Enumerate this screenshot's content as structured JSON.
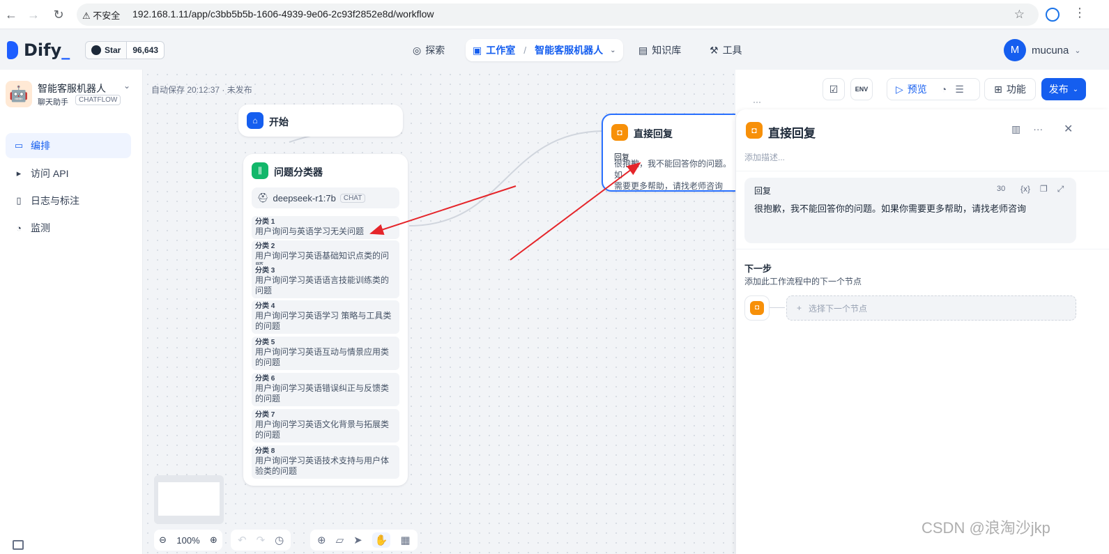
{
  "browser": {
    "insecure_label": "不安全",
    "url": "192.168.1.11/app/c3bb5b5b-1606-4939-9e06-2c93f2852e8d/workflow"
  },
  "header": {
    "logo": "Dify",
    "github": {
      "label": "Star",
      "count": "96,643"
    },
    "nav": {
      "explore": "探索",
      "studio": "工作室",
      "current_app": "智能客服机器人",
      "knowledge": "知识库",
      "tools": "工具"
    },
    "user": {
      "initial": "M",
      "name": "mucuna"
    }
  },
  "sidebar": {
    "app_name": "智能客服机器人",
    "app_type": "聊天助手",
    "app_mode": "CHATFLOW",
    "items": [
      {
        "label": "编排",
        "icon": "layout-icon"
      },
      {
        "label": "访问 API",
        "icon": "terminal-icon"
      },
      {
        "label": "日志与标注",
        "icon": "file-icon"
      },
      {
        "label": "监测",
        "icon": "monitor-icon"
      }
    ]
  },
  "canvas": {
    "autosave": "自动保存 20:12:37 · 未发布",
    "start_node": {
      "title": "开始"
    },
    "classifier_node": {
      "title": "问题分类器",
      "model": "deepseek-r1:7b",
      "model_badge": "CHAT",
      "classes": [
        {
          "name": "分类 1",
          "desc": "用户询问与英语学习无关问题"
        },
        {
          "name": "分类 2",
          "desc": "用户询问学习英语基础知识点类的问题"
        },
        {
          "name": "分类 3",
          "desc": "用户询问学习英语语言技能训练类的问题"
        },
        {
          "name": "分类 4",
          "desc": "用户询问学习英语学习 策略与工具类的问题"
        },
        {
          "name": "分类 5",
          "desc": "用户询问学习英语互动与情景应用类的问题"
        },
        {
          "name": "分类 6",
          "desc": "用户询问学习英语错误纠正与反馈类的问题"
        },
        {
          "name": "分类 7",
          "desc": "用户询问学习英语文化背景与拓展类的问题"
        },
        {
          "name": "分类 8",
          "desc": "用户询问学习英语技术支持与用户体验类的问题"
        }
      ]
    },
    "reply_node": {
      "title": "直接回复",
      "label": "回复",
      "text": "很抱歉，我不能回答你的问题。如\n需要更多帮助，请找老师咨询"
    },
    "zoom": "100%",
    "actions": {
      "preview": "预览",
      "features": "功能",
      "publish": "发布"
    }
  },
  "panel": {
    "title": "直接回复",
    "description_placeholder": "添加描述...",
    "reply_label": "回复",
    "reply_count": "30",
    "reply_text": "很抱歉，我不能回答你的问题。如果你需要更多帮助，请找老师咨询",
    "next_step_title": "下一步",
    "next_step_desc": "添加此工作流程中的下一个节点",
    "select_next": "选择下一个节点"
  },
  "watermark": "CSDN @浪淘沙jkp",
  "colors": {
    "accent": "#155eef",
    "reply_node": "#f79009",
    "classifier_node": "#12b76a",
    "arrow": "#e5252a"
  }
}
